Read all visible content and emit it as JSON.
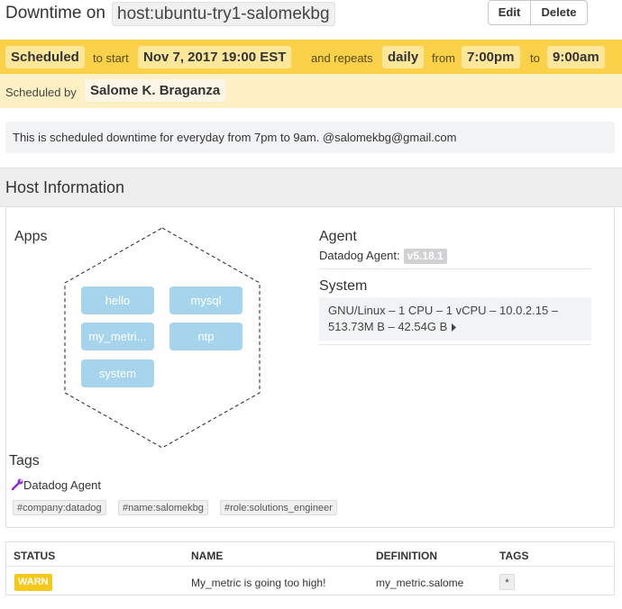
{
  "header": {
    "title": "Downtime on",
    "host": "host:ubuntu-try1-salomekbg",
    "edit_label": "Edit",
    "delete_label": "Delete"
  },
  "schedule": {
    "status": "Scheduled",
    "to_start": "to start",
    "start": "Nov 7, 2017 19:00 EST",
    "and_repeats": "and repeats",
    "repeat": "daily",
    "from_word": "from",
    "from_time": "7:00pm",
    "to_word": "to",
    "to_time": "9:00am",
    "scheduled_by_label": "Scheduled by",
    "scheduled_by": "Salome K. Braganza",
    "bar_color": "#fbd14a"
  },
  "message": "This is scheduled downtime for everyday from 7pm to 9am. @salomekbg@gmail.com",
  "host_info": {
    "heading": "Host Information",
    "apps_label": "Apps",
    "apps": [
      "hello",
      "mysql",
      "my_metri...",
      "ntp",
      "system"
    ],
    "agent_label": "Agent",
    "agent_name": "Datadog Agent:",
    "agent_version": "v5.18.1",
    "system_label": "System",
    "system_line1": "GNU/Linux – 1 CPU – 1 vCPU – 10.0.2.15 –",
    "system_line2": "513.73M B – 42.54G B",
    "system_more_icon": "triangle-right-icon",
    "tags_label": "Tags",
    "tag_source": "Datadog Agent",
    "tag_source_icon": "wrench-icon",
    "tags": [
      "#company:datadog",
      "#name:salomekbg",
      "#role:solutions_engineer"
    ]
  },
  "monitors": {
    "columns": [
      "STATUS",
      "NAME",
      "DEFINITION",
      "TAGS"
    ],
    "rows": [
      {
        "status": "WARN",
        "name": "My_metric is going too high!",
        "definition": "my_metric.salome",
        "tags": "*"
      }
    ],
    "warn_color": "#f5c81a"
  }
}
